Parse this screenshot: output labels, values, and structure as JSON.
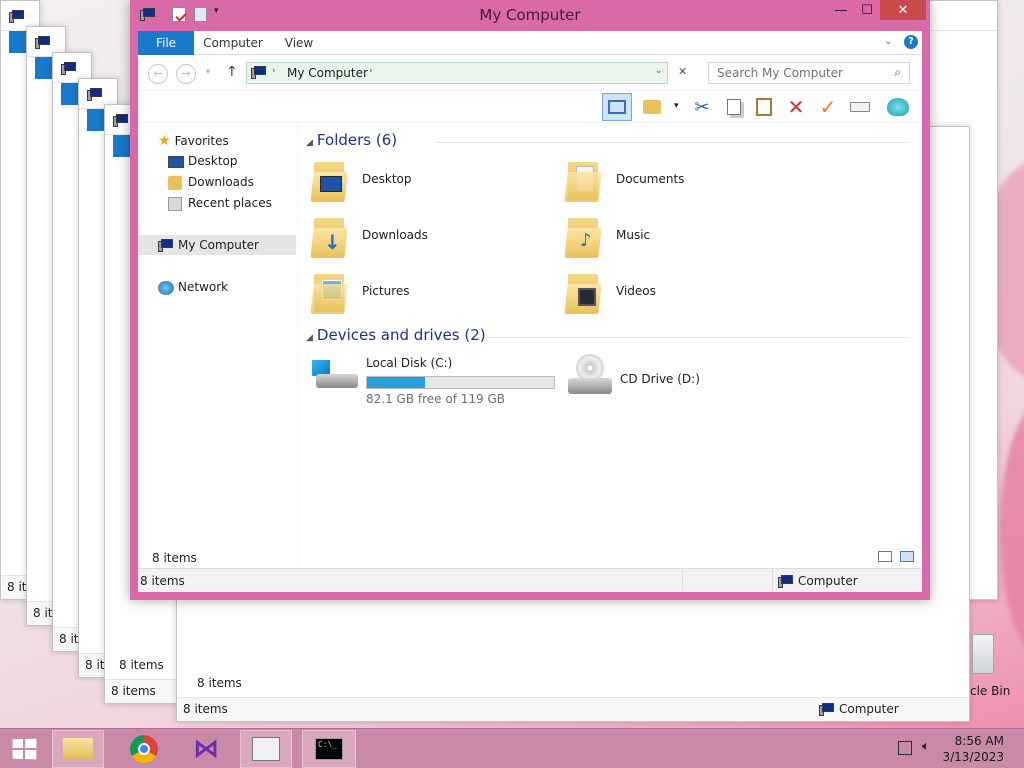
{
  "window": {
    "title": "My Computer",
    "minimize_glyph": "—",
    "maximize_glyph": "☐",
    "close_glyph": "✕"
  },
  "ribbon": {
    "tabs": [
      {
        "label": "File",
        "active": true
      },
      {
        "label": "Computer"
      },
      {
        "label": "View"
      }
    ],
    "help_glyph": "?"
  },
  "address": {
    "path": "My Computer",
    "search_placeholder": "Search My Computer"
  },
  "nav_pane": {
    "favorites": {
      "label": "Favorites",
      "items": [
        {
          "label": "Desktop"
        },
        {
          "label": "Downloads"
        },
        {
          "label": "Recent places"
        }
      ]
    },
    "computer": {
      "label": "My Computer"
    },
    "network": {
      "label": "Network"
    }
  },
  "content": {
    "folders_header": "Folders (6)",
    "folders": [
      {
        "label": "Desktop",
        "icon": "desktop-folder-icon"
      },
      {
        "label": "Documents",
        "icon": "documents-folder-icon"
      },
      {
        "label": "Downloads",
        "icon": "downloads-folder-icon"
      },
      {
        "label": "Music",
        "icon": "music-folder-icon"
      },
      {
        "label": "Pictures",
        "icon": "pictures-folder-icon"
      },
      {
        "label": "Videos",
        "icon": "videos-folder-icon"
      }
    ],
    "drives_header": "Devices and drives (2)",
    "drives": [
      {
        "label": "Local Disk (C:)",
        "free": "82.1 GB free of 119 GB",
        "used_fraction": 0.31
      },
      {
        "label": "CD Drive (D:)"
      }
    ]
  },
  "status": {
    "items_inner": "8 items",
    "items_outer": "8 items",
    "location": "Computer"
  },
  "background_windows": {
    "items_labels": [
      "8 it",
      "8 it",
      "8 it",
      "8 it",
      "8 items",
      "8 items",
      "8 items"
    ],
    "location": "Computer",
    "recycle_bin_partial": "cle Bin"
  },
  "taskbar": {
    "time": "8:56 AM",
    "date": "3/13/2023"
  },
  "colors": {
    "accent": "#1979ca",
    "frame": "#da6aa7",
    "progress": "#26a0da"
  }
}
